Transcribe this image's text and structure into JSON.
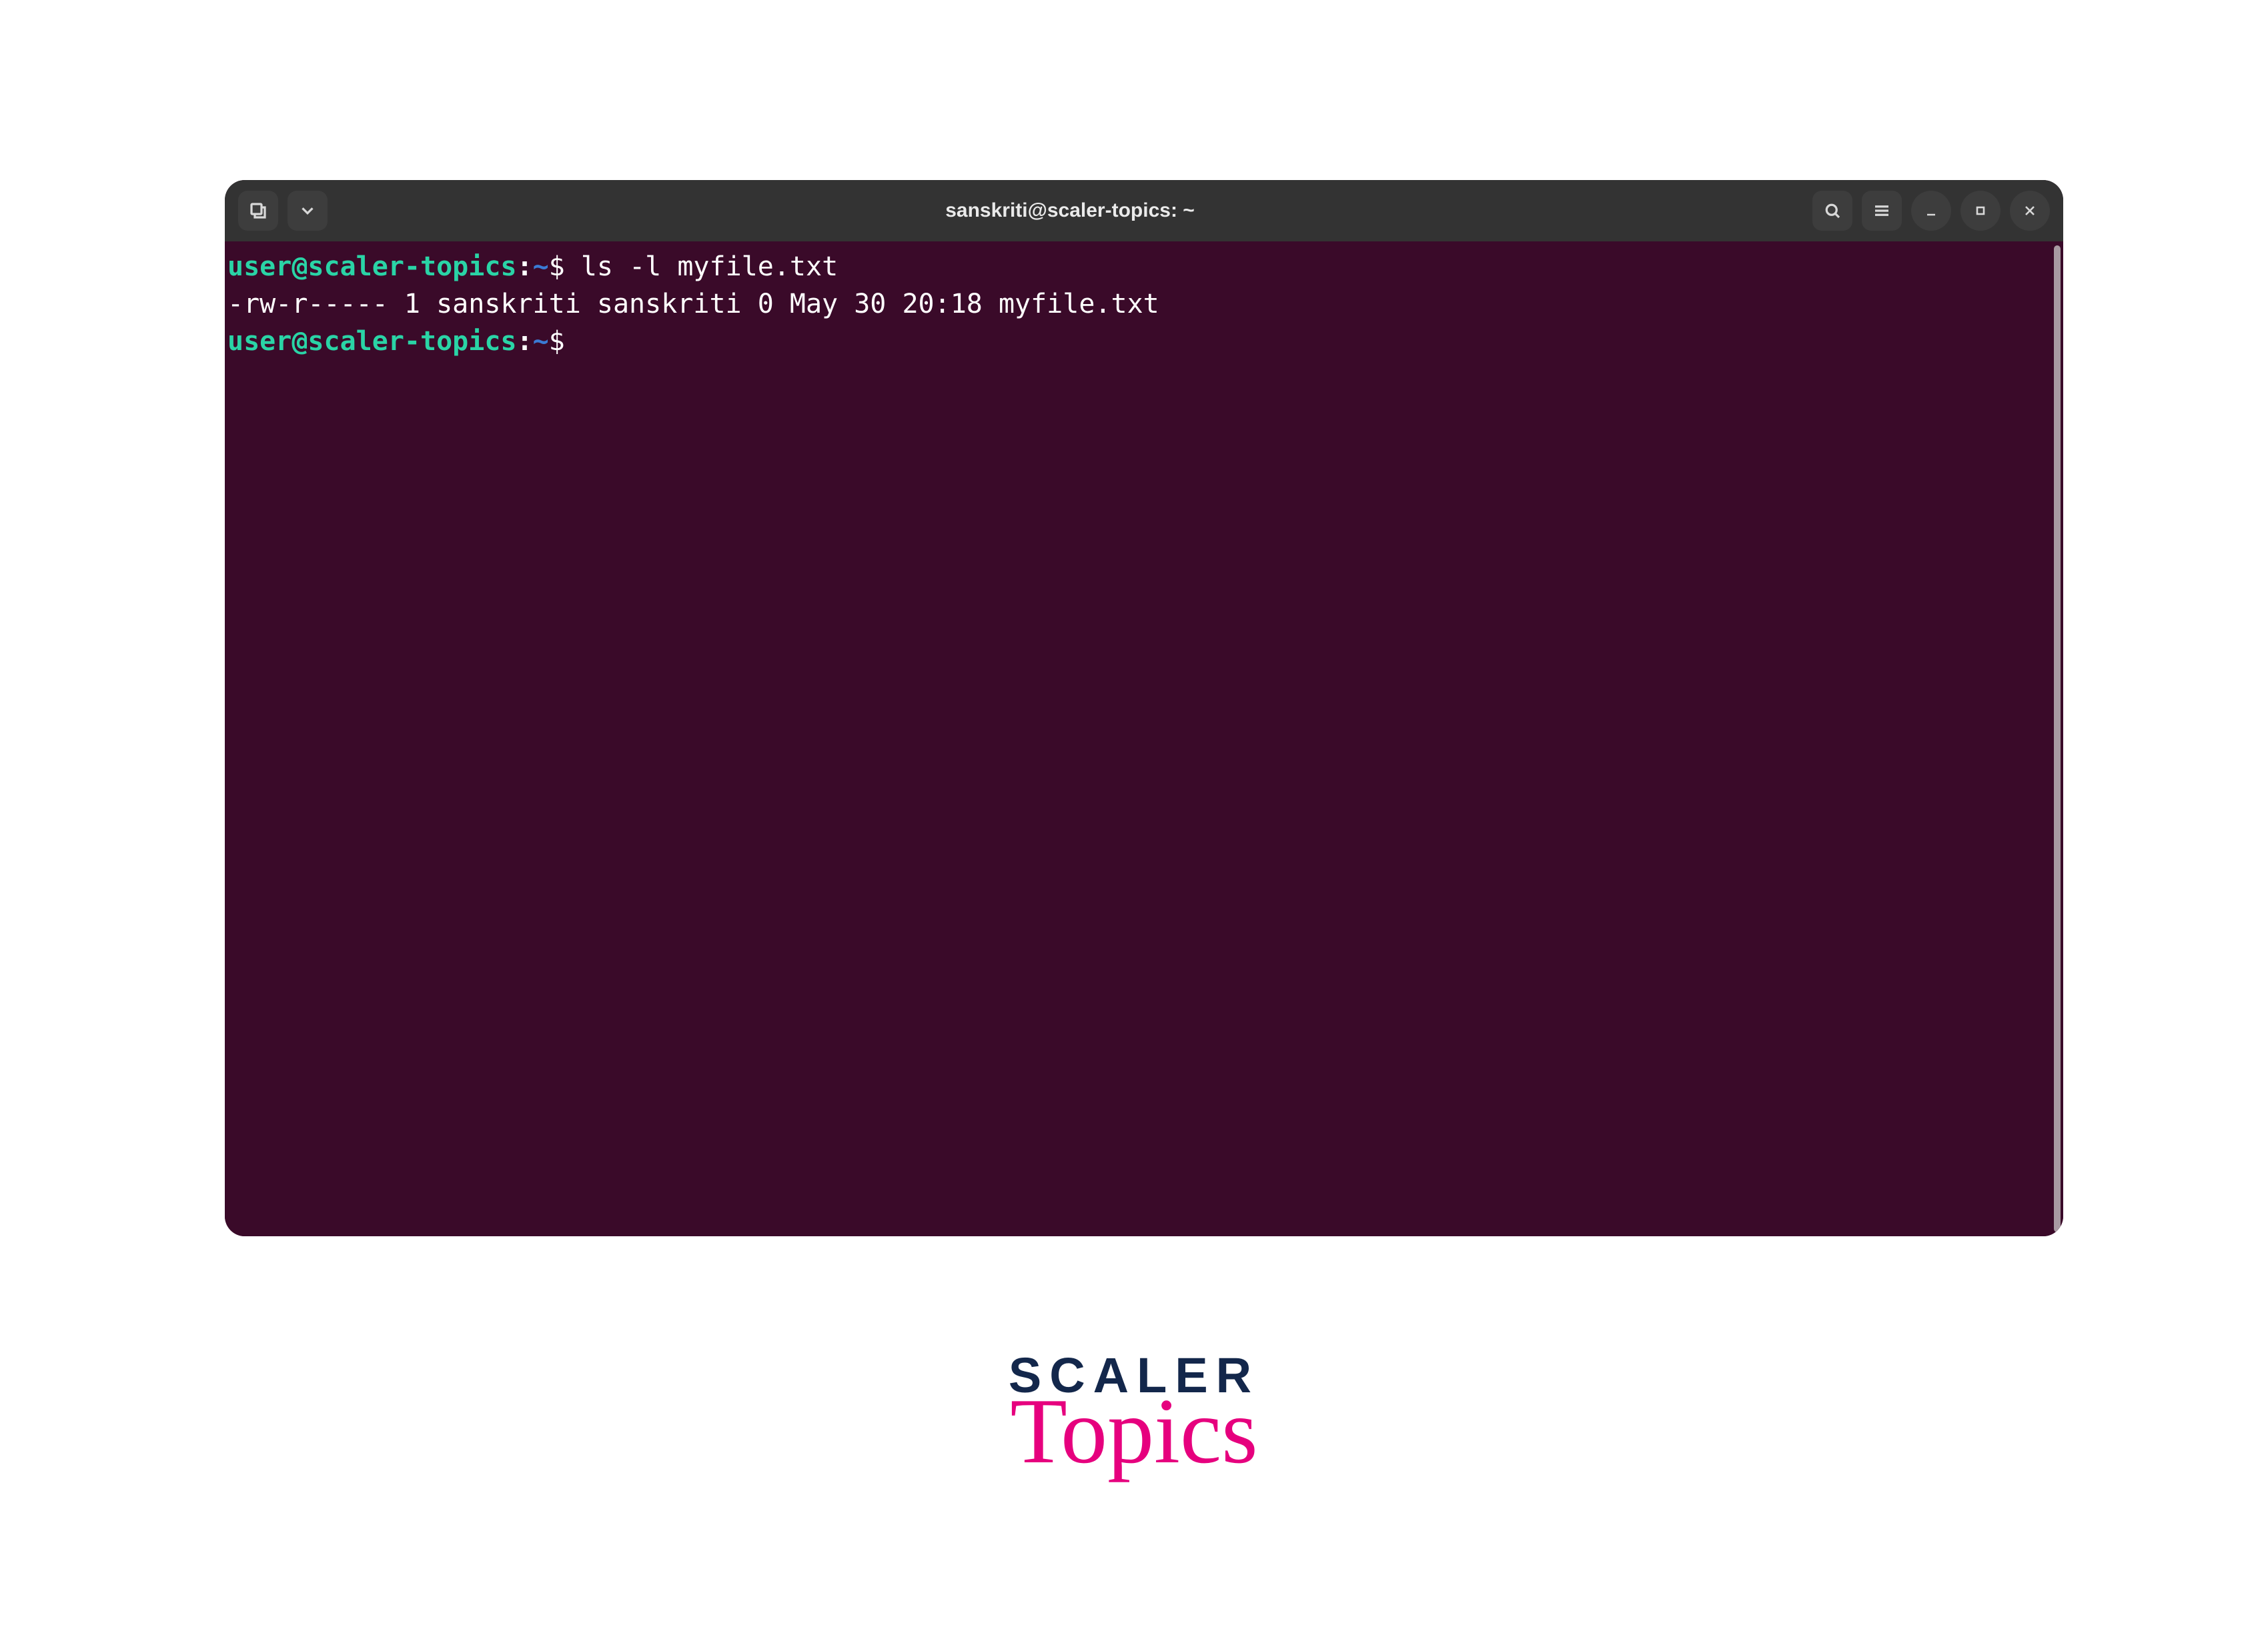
{
  "titlebar": {
    "title": "sanskriti@scaler-topics: ~"
  },
  "terminal": {
    "lines": [
      {
        "user": "user@scaler-topics",
        "colon": ":",
        "tilde": "~",
        "dollar": "$",
        "command": " ls -l myfile.txt"
      },
      {
        "output": "-rw-r----- 1 sanskriti sanskriti 0 May 30 20:18 myfile.txt"
      },
      {
        "user": "user@scaler-topics",
        "colon": ":",
        "tilde": "~",
        "dollar": "$",
        "command": ""
      }
    ]
  },
  "logo": {
    "top": "SCALER",
    "bottom": "Topics"
  }
}
